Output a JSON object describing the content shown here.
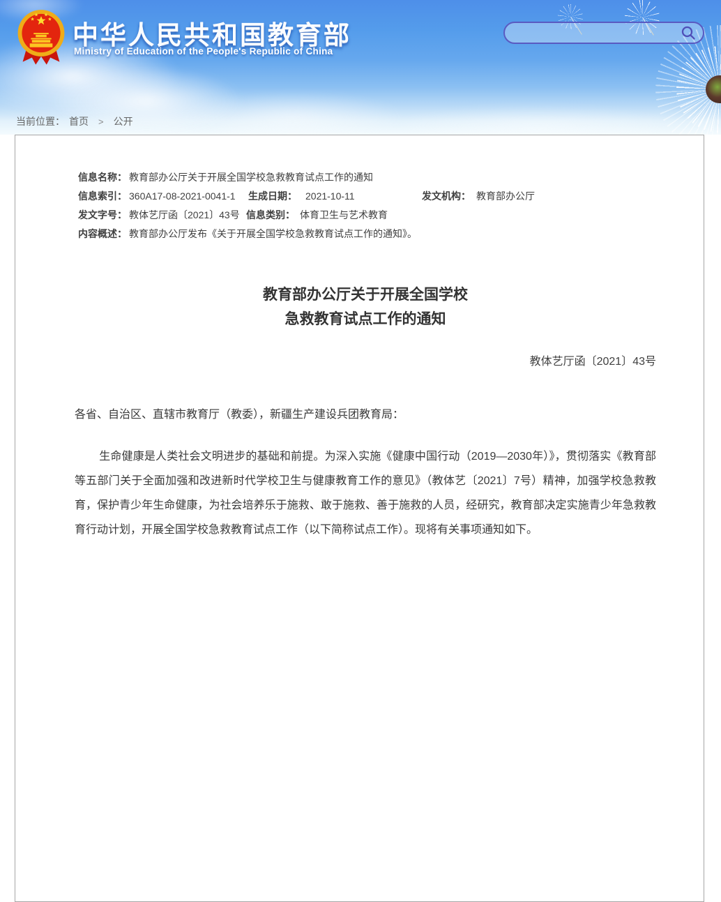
{
  "colors": {
    "header_blue_top": "#4e8fe9",
    "header_blue_bottom": "#f4fbfe",
    "search_accent": "#5a5ac1",
    "box_border": "#a6a6a6",
    "text_primary": "#3a3a3a",
    "breadcrumb_text": "#666666",
    "emblem_red": "#e3250e",
    "emblem_gold": "#efac18"
  },
  "header": {
    "site_title": "中华人民共和国教育部",
    "site_subtitle": "Ministry of Education of the People's Republic of China",
    "search_value": ""
  },
  "icons": {
    "emblem": "national-emblem",
    "search": "magnifier",
    "dandelion": "dandelion"
  },
  "breadcrumb": {
    "location_label": "当前位置：",
    "home": "首页",
    "separator": ">",
    "current": "公开"
  },
  "meta": {
    "name_label": "信息名称：",
    "name_value": "教育部办公厅关于开展全国学校急救教育试点工作的通知",
    "index_label": "信息索引：",
    "index_value": "360A17-08-2021-0041-1",
    "date_label": "生成日期：",
    "date_value": "2021-10-11",
    "org_label": "发文机构：",
    "org_value": "教育部办公厅",
    "docno_label": "发文字号：",
    "docno_value": "教体艺厅函〔2021〕43号",
    "type_label": "信息类别：",
    "type_value": "体育卫生与艺术教育",
    "summary_label": "内容概述：",
    "summary_value": "教育部办公厅发布《关于开展全国学校急救教育试点工作的通知》。"
  },
  "document": {
    "title_line1": "教育部办公厅关于开展全国学校",
    "title_line2": "急救教育试点工作的通知",
    "doc_number": "教体艺厅函〔2021〕43号",
    "salutation": "各省、自治区、直辖市教育厅（教委），新疆生产建设兵团教育局：",
    "paragraph1": "生命健康是人类社会文明进步的基础和前提。为深入实施《健康中国行动（2019—2030年）》，贯彻落实《教育部等五部门关于全面加强和改进新时代学校卫生与健康教育工作的意见》（教体艺〔2021〕7号）精神，加强学校急救教育，保护青少年生命健康，为社会培养乐于施救、敢于施救、善于施救的人员，经研究，教育部决定实施青少年急救教育行动计划，开展全国学校急救教育试点工作（以下简称试点工作）。现将有关事项通知如下。"
  }
}
